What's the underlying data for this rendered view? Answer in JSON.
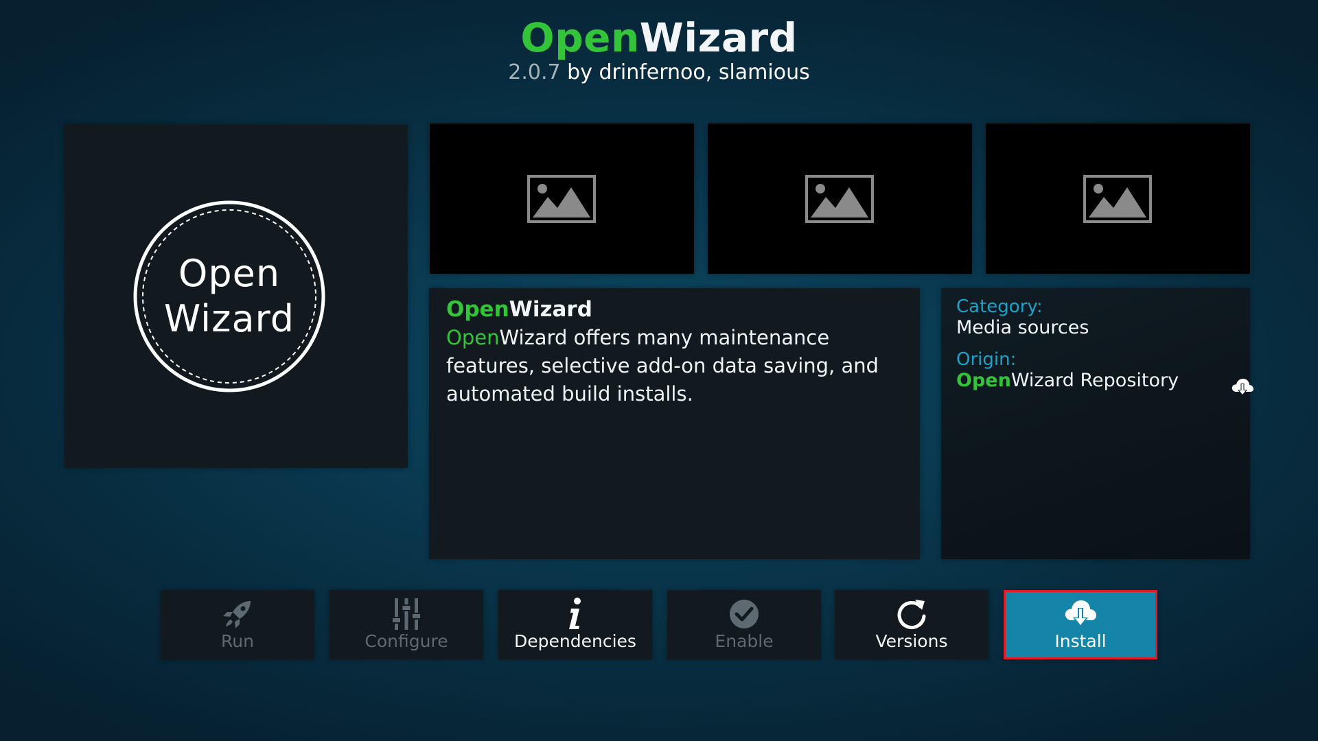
{
  "header": {
    "title_green": "Open",
    "title_white": "Wizard",
    "version": "2.0.7",
    "by_line": " by drinfernoo, slamious"
  },
  "logo": {
    "line1": "Open",
    "line2": "Wizard"
  },
  "screenshots": [
    {
      "icon": "image-placeholder-icon"
    },
    {
      "icon": "image-placeholder-icon"
    },
    {
      "icon": "image-placeholder-icon"
    }
  ],
  "description": {
    "heading_green": "Open",
    "heading_white": "Wizard",
    "body_green": "Open",
    "body_rest": "Wizard offers many maintenance features, selective add-on data saving, and automated build installs."
  },
  "info": {
    "category_label": "Category:",
    "category_value": "Media sources",
    "origin_label": "Origin:",
    "origin_green": "Open",
    "origin_rest": "Wizard Repository",
    "origin_icon": "cloud-download-icon"
  },
  "buttons": [
    {
      "id": "run",
      "label": "Run",
      "icon": "rocket-icon",
      "enabled": false
    },
    {
      "id": "configure",
      "label": "Configure",
      "icon": "sliders-icon",
      "enabled": false
    },
    {
      "id": "dependencies",
      "label": "Dependencies",
      "icon": "info-icon",
      "enabled": true
    },
    {
      "id": "enable",
      "label": "Enable",
      "icon": "check-circle-icon",
      "enabled": false
    },
    {
      "id": "versions",
      "label": "Versions",
      "icon": "refresh-icon",
      "enabled": true
    },
    {
      "id": "install",
      "label": "Install",
      "icon": "cloud-download-icon",
      "enabled": true,
      "focused": true
    }
  ],
  "colors": {
    "accent_green": "#34c43a",
    "label_blue": "#1aa3c9",
    "install_bg": "#1485a8",
    "focus_border": "#e51b2a",
    "panel_bg": "#121a1f"
  }
}
